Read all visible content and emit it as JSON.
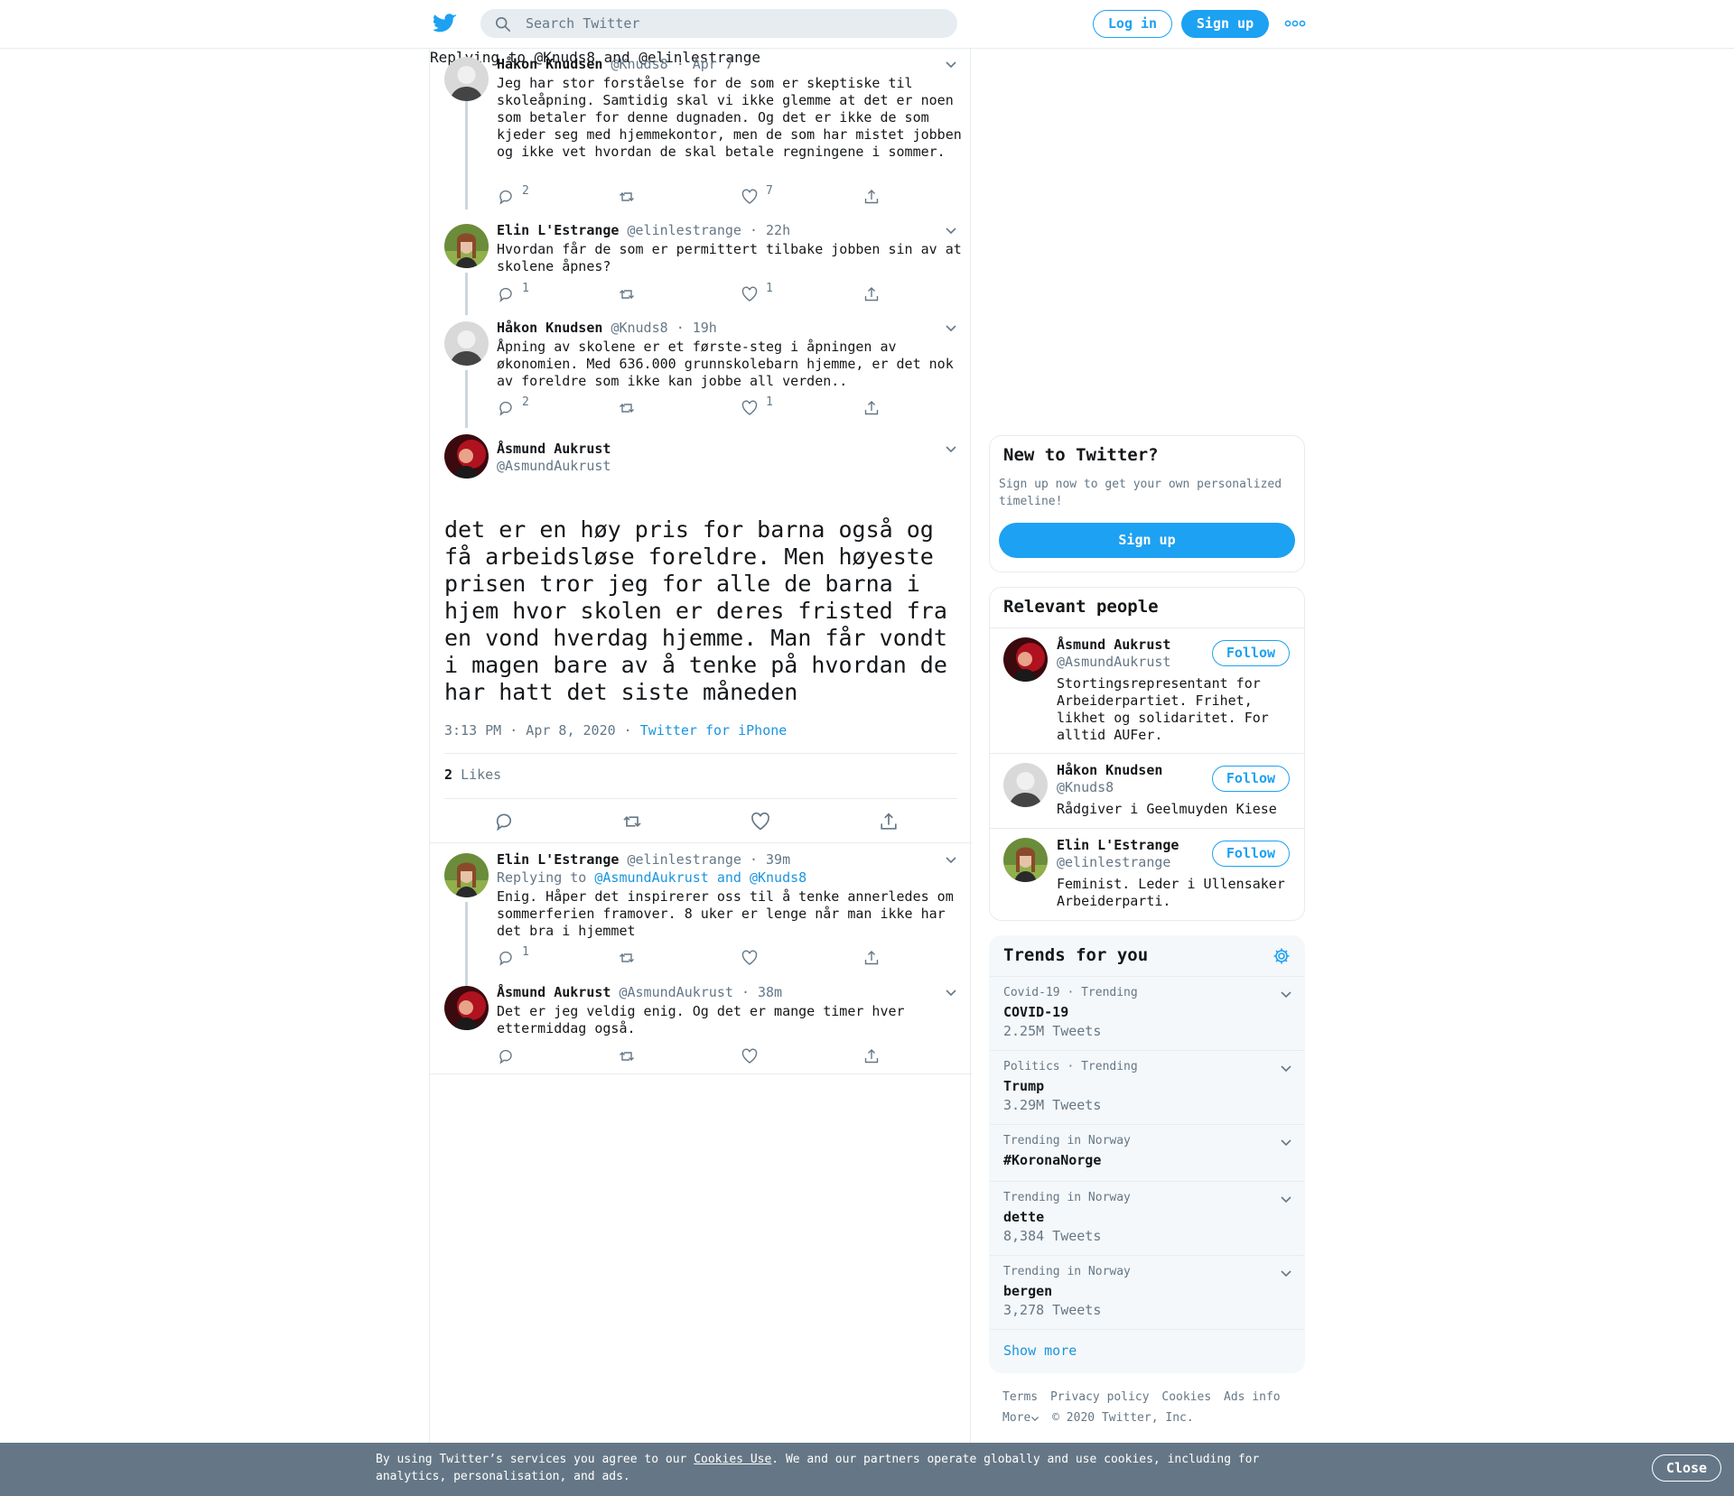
{
  "header": {
    "search_placeholder": "Search Twitter",
    "login_label": "Log in",
    "signup_label": "Sign up",
    "more_icon": "more-dots-icon",
    "accent_color": "#1da1f2"
  },
  "thread": [
    {
      "name": "Håkon Knudsen",
      "handle": "@Knuds8",
      "time": "· Apr 7",
      "text": "Jeg har stor forståelse for de som er skeptiske til skoleåpning. Samtidig skal vi ikke glemme at det er noen som betaler for denne dugnaden. Og det er ikke de som kjeder seg med hjemmekontor, men de som har mistet jobben og ikke vet hvordan de skal betale regningene i sommer.",
      "replies": "2",
      "likes": "7"
    },
    {
      "name": "Elin L'Estrange",
      "handle": "@elinlestrange",
      "time": "· 22h",
      "text": "Hvordan får de som er permittert tilbake jobben sin av at skolene åpnes?",
      "replies": "1",
      "likes": "1"
    },
    {
      "name": "Håkon Knudsen",
      "handle": "@Knuds8",
      "time": "· 19h",
      "text": "Åpning av skolene er et første-steg i åpningen av økonomien. Med 636.000 grunnskolebarn hjemme, er det nok av foreldre som ikke kan jobbe all verden..",
      "replies": "2",
      "likes": "1"
    }
  ],
  "focus": {
    "name": "Åsmund Aukrust",
    "handle": "@AsmundAukrust",
    "replying_prefix": "Replying to",
    "replying_to": "@Knuds8 and @elinlestrange",
    "text": "det er en høy pris for barna også og få arbeidsløse foreldre. Men høyeste prisen tror jeg for alle de barna i hjem hvor skolen er deres fristed fra en vond hverdag hjemme. Man får vondt i magen bare av å tenke på hvordan de har hatt det siste måneden",
    "timestamp": "3:13 PM · Apr 8, 2020",
    "source": "Twitter for iPhone",
    "likes_count": "2",
    "likes_label": "Likes"
  },
  "replies": [
    {
      "name": "Elin L'Estrange",
      "handle": "@elinlestrange",
      "time": "· 39m",
      "replying_prefix": "Replying to",
      "replying_to": "@AsmundAukrust and @Knuds8",
      "text": "Enig. Håper det inspirerer oss til å tenke annerledes om sommerferien framover. 8 uker er lenge når man ikke har det bra i hjemmet",
      "replies": "1",
      "likes": ""
    },
    {
      "name": "Åsmund Aukrust",
      "handle": "@AsmundAukrust",
      "time": "· 38m",
      "text": "Det er jeg veldig enig. Og det er mange timer hver ettermiddag også.",
      "replies": "",
      "likes": ""
    }
  ],
  "new_to_twitter": {
    "title": "New to Twitter?",
    "subtitle": "Sign up now to get your own personalized timeline!",
    "button": "Sign up"
  },
  "relevant_people": {
    "title": "Relevant people",
    "follow_label": "Follow",
    "people": [
      {
        "name": "Åsmund Aukrust",
        "handle": "@AsmundAukrust",
        "bio": "Stortingsrepresentant for Arbeiderpartiet. Frihet, likhet og solidaritet. For alltid AUFer."
      },
      {
        "name": "Håkon Knudsen",
        "handle": "@Knuds8",
        "bio": "Rådgiver i Geelmuyden Kiese"
      },
      {
        "name": "Elin L'Estrange",
        "handle": "@elinlestrange",
        "bio": "Feminist. Leder i Ullensaker Arbeiderparti."
      }
    ]
  },
  "trends": {
    "title": "Trends for you",
    "items": [
      {
        "context": "Covid-19 · Trending",
        "name": "COVID-19",
        "count": "2.25M Tweets"
      },
      {
        "context": "Politics · Trending",
        "name": "Trump",
        "count": "3.29M Tweets"
      },
      {
        "context": "Trending in Norway",
        "name": "#KoronaNorge",
        "count": ""
      },
      {
        "context": "Trending in Norway",
        "name": "dette",
        "count": "8,384 Tweets"
      },
      {
        "context": "Trending in Norway",
        "name": "bergen",
        "count": "3,278 Tweets"
      }
    ],
    "show_more": "Show more"
  },
  "footer": {
    "links": [
      "Terms",
      "Privacy policy",
      "Cookies",
      "Ads info"
    ],
    "more": "More",
    "copyright": "© 2020 Twitter, Inc."
  },
  "cookie_bar": {
    "text_before": "By using Twitter’s services you agree to our ",
    "link": "Cookies Use",
    "text_after": ". We and our partners operate globally and use cookies, including for analytics, personalisation, and ads.",
    "close": "Close"
  }
}
